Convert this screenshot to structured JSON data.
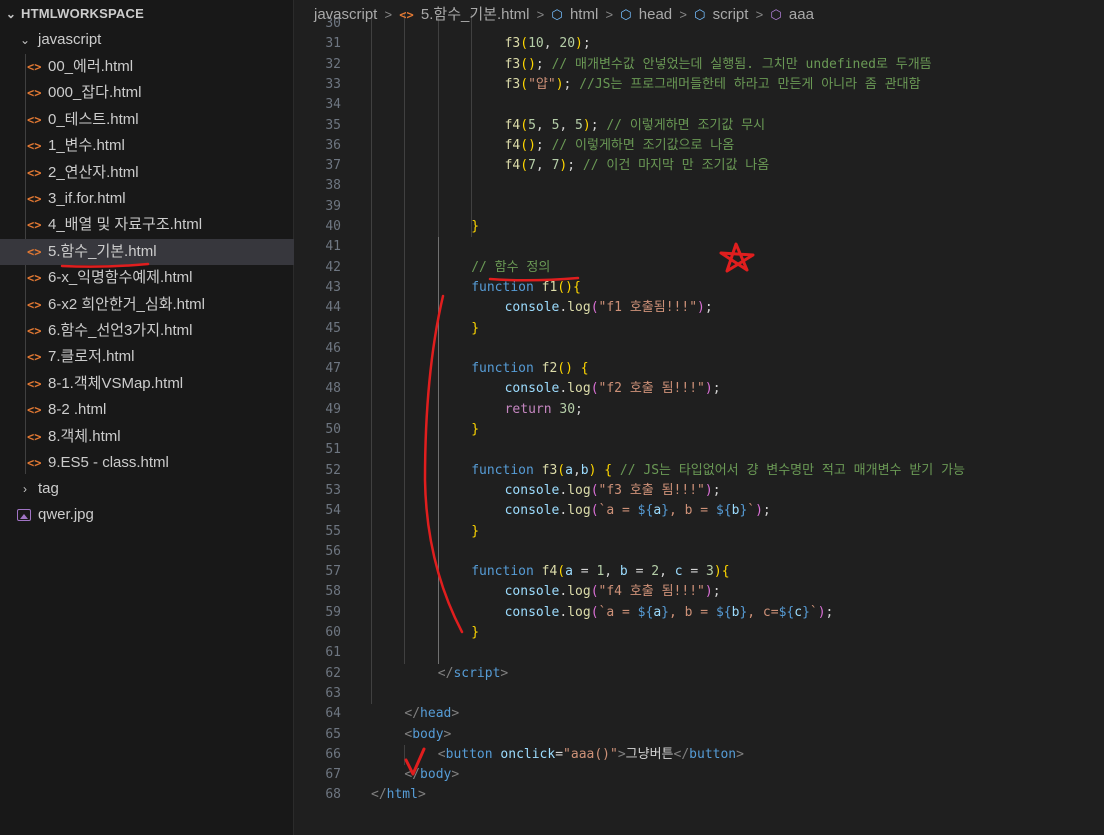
{
  "explorer": {
    "root_label": "HTMLWORKSPACE",
    "folders": [
      {
        "label": "javascript",
        "expanded": true
      },
      {
        "label": "tag",
        "expanded": false
      }
    ],
    "files": [
      "00_에러.html",
      "000_잡다.html",
      "0_테스트.html",
      "1_변수.html",
      "2_연산자.html",
      "3_if.for.html",
      "4_배열 및 자료구조.html",
      "5.함수_기본.html",
      "6-x_익명함수예제.html",
      "6-x2 희안한거_심화.html",
      "6.함수_선언3가지.html",
      "7.클로저.html",
      "8-1.객체VSMap.html",
      "8-2 .html",
      "8.객체.html",
      "9.ES5 - class.html"
    ],
    "selected_file_index": 7,
    "image_file": "qwer.jpg",
    "icons": {
      "file": "html-file-icon",
      "image": "image-file-icon"
    }
  },
  "breadcrumb": {
    "items": [
      "javascript",
      "5.함수_기본.html",
      "html",
      "head",
      "script",
      "aaa"
    ]
  },
  "code_lines": [
    {
      "n": "30",
      "i": 0,
      "t": []
    },
    {
      "n": "31",
      "i": 4,
      "t": [
        [
          "fn",
          "f3"
        ],
        [
          "p1",
          "("
        ],
        [
          "num",
          "10"
        ],
        [
          "tx",
          ", "
        ],
        [
          "num",
          "20"
        ],
        [
          "p1",
          ")"
        ],
        [
          "tx",
          ";"
        ]
      ]
    },
    {
      "n": "32",
      "i": 4,
      "t": [
        [
          "fn",
          "f3"
        ],
        [
          "p1",
          "()"
        ],
        [
          "tx",
          "; "
        ],
        [
          "cm",
          "// 매개변수값 안넣었는데 실행됨. 그치만 undefined로 두개뜸"
        ]
      ]
    },
    {
      "n": "33",
      "i": 4,
      "t": [
        [
          "fn",
          "f3"
        ],
        [
          "p1",
          "("
        ],
        [
          "str",
          "\"얍\""
        ],
        [
          "p1",
          ")"
        ],
        [
          "tx",
          "; "
        ],
        [
          "cm",
          "//JS는 프로그래머들한테 하라고 만든게 아니라 좀 관대함"
        ]
      ]
    },
    {
      "n": "34",
      "i": 4,
      "t": []
    },
    {
      "n": "35",
      "i": 4,
      "t": [
        [
          "fn",
          "f4"
        ],
        [
          "p1",
          "("
        ],
        [
          "num",
          "5"
        ],
        [
          "tx",
          ", "
        ],
        [
          "num",
          "5"
        ],
        [
          "tx",
          ", "
        ],
        [
          "num",
          "5"
        ],
        [
          "p1",
          ")"
        ],
        [
          "tx",
          "; "
        ],
        [
          "cm",
          "// 이렇게하면 조기값 무시"
        ]
      ]
    },
    {
      "n": "36",
      "i": 4,
      "t": [
        [
          "fn",
          "f4"
        ],
        [
          "p1",
          "()"
        ],
        [
          "tx",
          "; "
        ],
        [
          "cm",
          "// 이렇게하면 조기값으로 나옴"
        ]
      ]
    },
    {
      "n": "37",
      "i": 4,
      "t": [
        [
          "fn",
          "f4"
        ],
        [
          "p1",
          "("
        ],
        [
          "num",
          "7"
        ],
        [
          "tx",
          ", "
        ],
        [
          "num",
          "7"
        ],
        [
          "p1",
          ")"
        ],
        [
          "tx",
          "; "
        ],
        [
          "cm",
          "// 이건 마지막 만 조기값 나옴"
        ]
      ]
    },
    {
      "n": "38",
      "i": 4,
      "t": []
    },
    {
      "n": "39",
      "i": 4,
      "t": []
    },
    {
      "n": "40",
      "i": 3,
      "t": [
        [
          "p1",
          "}"
        ]
      ]
    },
    {
      "n": "41",
      "i": 3,
      "t": []
    },
    {
      "n": "42",
      "i": 3,
      "t": [
        [
          "cm",
          "// 함수 정의"
        ]
      ]
    },
    {
      "n": "43",
      "i": 3,
      "t": [
        [
          "kw",
          "function"
        ],
        [
          "tx",
          " "
        ],
        [
          "fn",
          "f1"
        ],
        [
          "p1",
          "()"
        ],
        [
          "p1",
          "{"
        ]
      ]
    },
    {
      "n": "44",
      "i": 4,
      "t": [
        [
          "var",
          "console"
        ],
        [
          "tx",
          "."
        ],
        [
          "fn",
          "log"
        ],
        [
          "p2",
          "("
        ],
        [
          "str",
          "\"f1 호출됨!!!\""
        ],
        [
          "p2",
          ")"
        ],
        [
          "tx",
          ";"
        ]
      ]
    },
    {
      "n": "45",
      "i": 3,
      "t": [
        [
          "p1",
          "}"
        ]
      ]
    },
    {
      "n": "46",
      "i": 3,
      "t": []
    },
    {
      "n": "47",
      "i": 3,
      "t": [
        [
          "kw",
          "function"
        ],
        [
          "tx",
          " "
        ],
        [
          "fn",
          "f2"
        ],
        [
          "p1",
          "()"
        ],
        [
          "tx",
          " "
        ],
        [
          "p1",
          "{"
        ]
      ]
    },
    {
      "n": "48",
      "i": 4,
      "t": [
        [
          "var",
          "console"
        ],
        [
          "tx",
          "."
        ],
        [
          "fn",
          "log"
        ],
        [
          "p2",
          "("
        ],
        [
          "str",
          "\"f2 호출 됨!!!\""
        ],
        [
          "p2",
          ")"
        ],
        [
          "tx",
          ";"
        ]
      ]
    },
    {
      "n": "49",
      "i": 4,
      "t": [
        [
          "kw2",
          "return"
        ],
        [
          "tx",
          " "
        ],
        [
          "num",
          "30"
        ],
        [
          "tx",
          ";"
        ]
      ]
    },
    {
      "n": "50",
      "i": 3,
      "t": [
        [
          "p1",
          "}"
        ]
      ]
    },
    {
      "n": "51",
      "i": 3,
      "t": []
    },
    {
      "n": "52",
      "i": 3,
      "t": [
        [
          "kw",
          "function"
        ],
        [
          "tx",
          " "
        ],
        [
          "fn",
          "f3"
        ],
        [
          "p1",
          "("
        ],
        [
          "var",
          "a"
        ],
        [
          "tx",
          ","
        ],
        [
          "var",
          "b"
        ],
        [
          "p1",
          ")"
        ],
        [
          "tx",
          " "
        ],
        [
          "p1",
          "{"
        ],
        [
          "tx",
          " "
        ],
        [
          "cm",
          "// JS는 타입없어서 걍 변수명만 적고 매개변수 받기 가능"
        ]
      ]
    },
    {
      "n": "53",
      "i": 4,
      "t": [
        [
          "var",
          "console"
        ],
        [
          "tx",
          "."
        ],
        [
          "fn",
          "log"
        ],
        [
          "p2",
          "("
        ],
        [
          "str",
          "\"f3 호출 됨!!!\""
        ],
        [
          "p2",
          ")"
        ],
        [
          "tx",
          ";"
        ]
      ]
    },
    {
      "n": "54",
      "i": 4,
      "t": [
        [
          "var",
          "console"
        ],
        [
          "tx",
          "."
        ],
        [
          "fn",
          "log"
        ],
        [
          "p2",
          "("
        ],
        [
          "str",
          "`a = "
        ],
        [
          "tpl",
          "${"
        ],
        [
          "var",
          "a"
        ],
        [
          "tpl",
          "}"
        ],
        [
          "str",
          ", b = "
        ],
        [
          "tpl",
          "${"
        ],
        [
          "var",
          "b"
        ],
        [
          "tpl",
          "}"
        ],
        [
          "str",
          "`"
        ],
        [
          "p2",
          ")"
        ],
        [
          "tx",
          ";"
        ]
      ]
    },
    {
      "n": "55",
      "i": 3,
      "t": [
        [
          "p1",
          "}"
        ]
      ]
    },
    {
      "n": "56",
      "i": 3,
      "t": []
    },
    {
      "n": "57",
      "i": 3,
      "t": [
        [
          "kw",
          "function"
        ],
        [
          "tx",
          " "
        ],
        [
          "fn",
          "f4"
        ],
        [
          "p1",
          "("
        ],
        [
          "var",
          "a"
        ],
        [
          "tx",
          " = "
        ],
        [
          "num",
          "1"
        ],
        [
          "tx",
          ", "
        ],
        [
          "var",
          "b"
        ],
        [
          "tx",
          " = "
        ],
        [
          "num",
          "2"
        ],
        [
          "tx",
          ", "
        ],
        [
          "var",
          "c"
        ],
        [
          "tx",
          " = "
        ],
        [
          "num",
          "3"
        ],
        [
          "p1",
          ")"
        ],
        [
          "p1",
          "{"
        ]
      ]
    },
    {
      "n": "58",
      "i": 4,
      "t": [
        [
          "var",
          "console"
        ],
        [
          "tx",
          "."
        ],
        [
          "fn",
          "log"
        ],
        [
          "p2",
          "("
        ],
        [
          "str",
          "\"f4 호출 됨!!!\""
        ],
        [
          "p2",
          ")"
        ],
        [
          "tx",
          ";"
        ]
      ]
    },
    {
      "n": "59",
      "i": 4,
      "t": [
        [
          "var",
          "console"
        ],
        [
          "tx",
          "."
        ],
        [
          "fn",
          "log"
        ],
        [
          "p2",
          "("
        ],
        [
          "str",
          "`a = "
        ],
        [
          "tpl",
          "${"
        ],
        [
          "var",
          "a"
        ],
        [
          "tpl",
          "}"
        ],
        [
          "str",
          ", b = "
        ],
        [
          "tpl",
          "${"
        ],
        [
          "var",
          "b"
        ],
        [
          "tpl",
          "}"
        ],
        [
          "str",
          ", c="
        ],
        [
          "tpl",
          "${"
        ],
        [
          "var",
          "c"
        ],
        [
          "tpl",
          "}"
        ],
        [
          "str",
          "`"
        ],
        [
          "p2",
          ")"
        ],
        [
          "tx",
          ";"
        ]
      ]
    },
    {
      "n": "60",
      "i": 3,
      "t": [
        [
          "p1",
          "}"
        ]
      ]
    },
    {
      "n": "61",
      "i": 3,
      "t": []
    },
    {
      "n": "62",
      "i": 2,
      "t": [
        [
          "br",
          "</"
        ],
        [
          "tag",
          "script"
        ],
        [
          "br",
          ">"
        ]
      ]
    },
    {
      "n": "63",
      "i": 1,
      "t": []
    },
    {
      "n": "64",
      "i": 1,
      "t": [
        [
          "br",
          "</"
        ],
        [
          "tag",
          "head"
        ],
        [
          "br",
          ">"
        ]
      ]
    },
    {
      "n": "65",
      "i": 1,
      "t": [
        [
          "br",
          "<"
        ],
        [
          "tag",
          "body"
        ],
        [
          "br",
          ">"
        ]
      ]
    },
    {
      "n": "66",
      "i": 2,
      "t": [
        [
          "br",
          "<"
        ],
        [
          "tag",
          "button"
        ],
        [
          "tx",
          " "
        ],
        [
          "at",
          "onclick"
        ],
        [
          "tx",
          "="
        ],
        [
          "str",
          "\"aaa()\""
        ],
        [
          "br",
          ">"
        ],
        [
          "tx",
          "그냥버튼"
        ],
        [
          "br",
          "</"
        ],
        [
          "tag",
          "button"
        ],
        [
          "br",
          ">"
        ]
      ]
    },
    {
      "n": "67",
      "i": 1,
      "t": [
        [
          "br",
          "</"
        ],
        [
          "tag",
          "body"
        ],
        [
          "br",
          ">"
        ]
      ]
    },
    {
      "n": "68",
      "i": 0,
      "t": [
        [
          "br",
          "</"
        ],
        [
          "tag",
          "html"
        ],
        [
          "br",
          ">"
        ]
      ]
    }
  ],
  "colors": {
    "annotation": "#e01e1e",
    "selected_row": "#37373d",
    "html_icon": "#e37933"
  },
  "annotations": [
    "star-mark",
    "underline-function-definition",
    "vertical-bracket-line",
    "check-mark"
  ]
}
